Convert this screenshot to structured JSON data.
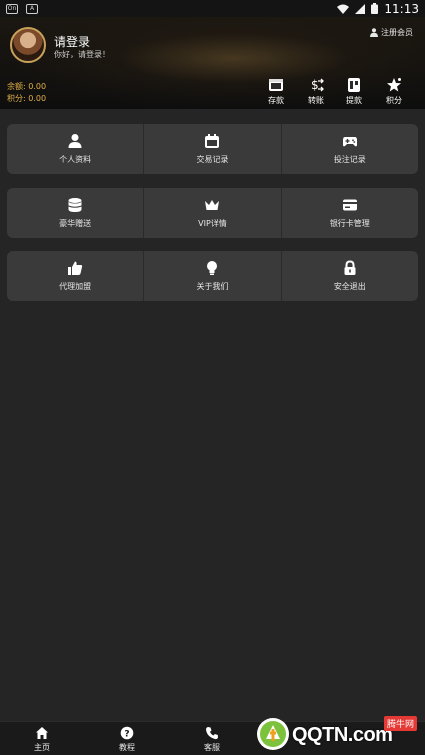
{
  "status_bar": {
    "left_icons": [
      "notification-icon",
      "app-icon"
    ],
    "time": "11:13"
  },
  "header": {
    "title": "请登录",
    "subtitle": "你好，请登录！",
    "register_label": "注册会员",
    "balance_label": "余额: 0.00",
    "points_label": "积分: 0.00",
    "accent_color": "#e2b14a",
    "quick_actions": [
      {
        "label": "存款",
        "icon": "wallet-icon"
      },
      {
        "label": "转账",
        "icon": "transfer-icon"
      },
      {
        "label": "提款",
        "icon": "withdraw-icon"
      },
      {
        "label": "积分",
        "icon": "star-icon"
      }
    ]
  },
  "menu": {
    "row1": [
      {
        "label": "个人资料",
        "icon": "user-icon"
      },
      {
        "label": "交易记录",
        "icon": "calendar-icon"
      },
      {
        "label": "投注记录",
        "icon": "gamepad-icon"
      }
    ],
    "row2": [
      {
        "label": "豪华赠送",
        "icon": "database-icon"
      },
      {
        "label": "VIP详情",
        "icon": "crown-icon"
      },
      {
        "label": "银行卡管理",
        "icon": "card-icon"
      }
    ],
    "row3": [
      {
        "label": "代理加盟",
        "icon": "thumbs-up-icon"
      },
      {
        "label": "关于我们",
        "icon": "bulb-icon"
      },
      {
        "label": "安全退出",
        "icon": "lock-icon"
      }
    ]
  },
  "bottom_nav": [
    {
      "label": "主页",
      "icon": "home-icon"
    },
    {
      "label": "教程",
      "icon": "help-icon"
    },
    {
      "label": "客服",
      "icon": "phone-icon"
    }
  ],
  "watermark": {
    "text": "QQTN.com",
    "badge": "腾牛网"
  }
}
